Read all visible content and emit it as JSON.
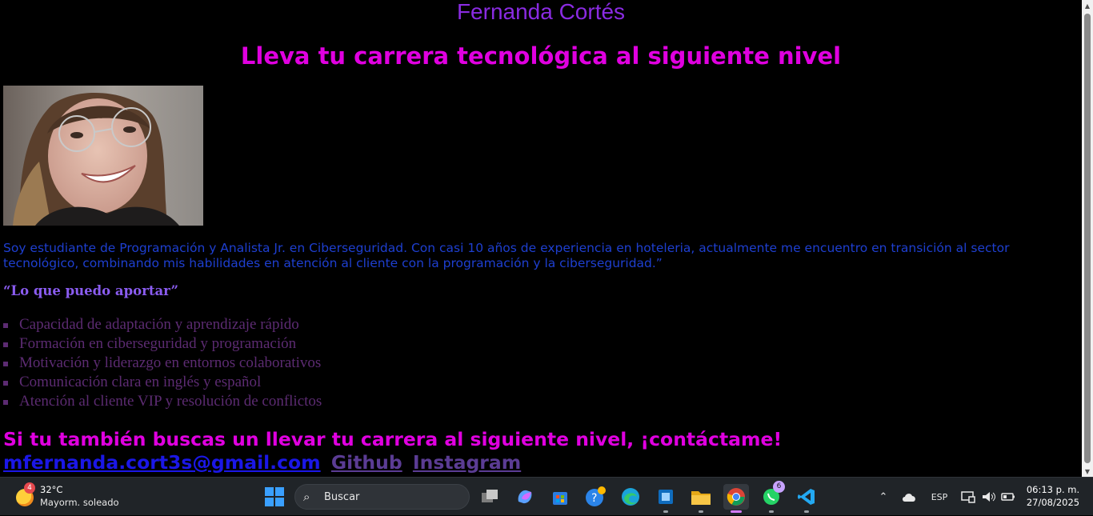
{
  "page": {
    "name": "Fernanda Cortés",
    "tagline": "Lleva tu carrera tecnológica al siguiente nivel",
    "bio": "Soy estudiante de Programación y Analista Jr. en Ciberseguridad. Con casi 10 años de experiencia en hoteleria, actualmente me encuentro en transición al sector tecnológico, combinando mis habilidades en atención al cliente con la programación y la ciberseguridad.”",
    "aport_heading": "“Lo que puedo aportar”",
    "skills": [
      "Capacidad de adaptación y aprendizaje rápido",
      "Formación en ciberseguridad y programación",
      "Motivación y liderazgo en entornos colaborativos",
      "Comunicación clara en inglés y español",
      "Atención al cliente VIP y resolución de conflictos"
    ],
    "cta": "Si tu también buscas un llevar tu carrera al siguiente nivel, ¡contáctame!",
    "links": {
      "email": "mfernanda.cort3s@gmail.com",
      "github": "Github",
      "instagram": "Instagram"
    }
  },
  "taskbar": {
    "weather": {
      "badge": "4",
      "temp": "32°C",
      "desc": "Mayorm. soleado"
    },
    "search_placeholder": "Buscar",
    "whatsapp_badge": "6",
    "language": "ESP",
    "time": "06:13 p. m.",
    "date": "27/08/2025",
    "icons": [
      "start-icon",
      "task-view-icon",
      "copilot-icon",
      "store-icon",
      "help-icon",
      "edge-icon",
      "app-icon",
      "file-explorer-icon",
      "chrome-icon",
      "whatsapp-icon",
      "vscode-icon"
    ]
  },
  "colors": {
    "name": "#8a2be2",
    "tagline": "#e000e0",
    "bio": "#1e3fd0",
    "skills": "#5c2b72",
    "email_link": "#1b17e6",
    "visited_link": "#5b3c94"
  }
}
